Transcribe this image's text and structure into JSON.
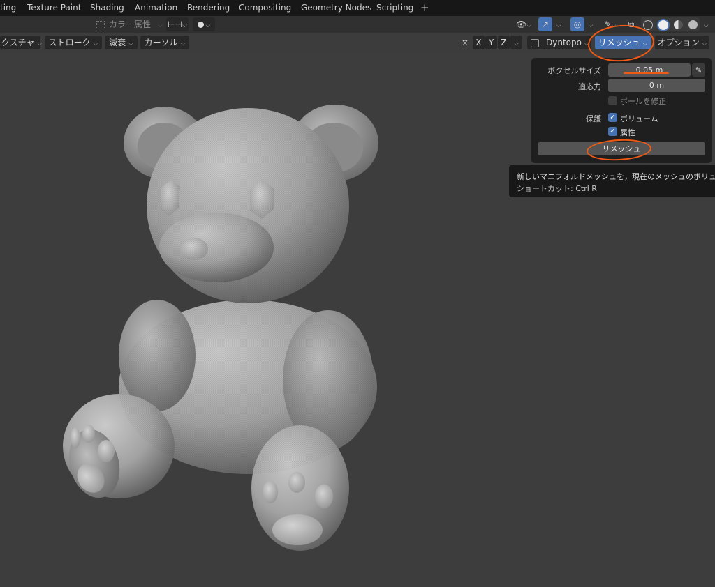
{
  "topbar": {
    "tabs": [
      "ting",
      "Texture Paint",
      "Shading",
      "Animation",
      "Rendering",
      "Compositing",
      "Geometry Nodes",
      "Scripting"
    ],
    "add_tab": "+"
  },
  "header": {
    "color_attribute": "カラー属性"
  },
  "toolbar": {
    "texture_menu": "クスチャ",
    "stroke_menu": "ストローク",
    "falloff_menu": "減衰",
    "cursor_menu": "カーソル",
    "axis_x": "X",
    "axis_y": "Y",
    "axis_z": "Z",
    "dyntopo_label": "Dyntopo",
    "remesh_menu": "リメッシュ",
    "options_menu": "オプション"
  },
  "remesh_panel": {
    "voxel_size_label": "ボクセルサイズ",
    "voxel_size_value": "0.05 m",
    "adaptivity_label": "適応力",
    "adaptivity_value": "0 m",
    "fix_poles_label": "ポールを修正",
    "fix_poles_checked": false,
    "preserve_label": "保護",
    "volume_label": "ボリューム",
    "volume_checked": true,
    "attributes_label": "属性",
    "attributes_checked": true,
    "remesh_button": "リメッシュ"
  },
  "tooltip": {
    "description": "新しいマニフォルドメッシュを，現在のメッシュのボリュ",
    "shortcut": "ショートカット: Ctrl R"
  },
  "colors": {
    "accent": "#4772b3",
    "annotation": "#f05a12",
    "viewport": "#3d3d3d",
    "panel": "#1f1f1f"
  }
}
